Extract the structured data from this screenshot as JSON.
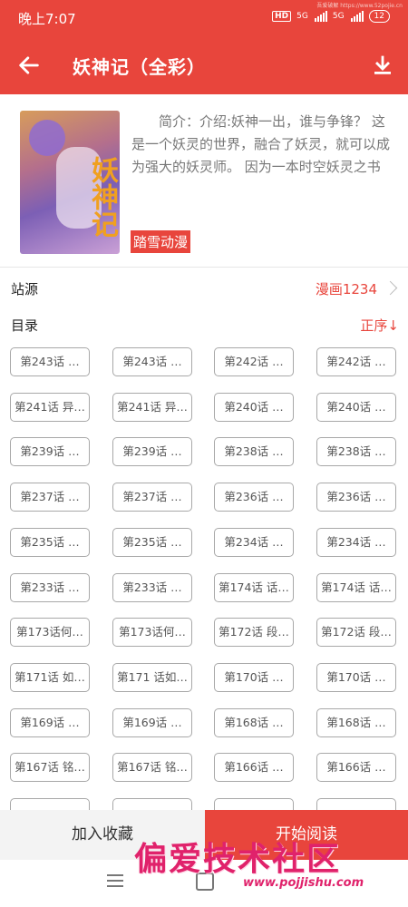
{
  "status": {
    "time": "晚上7:07",
    "network1": "5G",
    "network2": "5G",
    "battery": "12",
    "hd": "HD",
    "watermark": "吾爱破解 https://www.52pojie.cn"
  },
  "appbar": {
    "title": "妖神记（全彩）"
  },
  "info": {
    "description": "简介：介绍:妖神一出，谁与争锋？ 这是一个妖灵的世界，融合了妖灵，就可以成为强大的妖灵师。 因为一本时空妖灵之书",
    "cover_text": "妖神记",
    "tag": "踏雪动漫"
  },
  "source": {
    "label": "站源",
    "value": "漫画1234"
  },
  "toc": {
    "label": "目录",
    "order": "正序↓"
  },
  "chapters": [
    "第243话 …",
    "第243话 …",
    "第242话 …",
    "第242话 …",
    "第241话 异…",
    "第241话 异…",
    "第240话 …",
    "第240话 …",
    "第239话 …",
    "第239话 …",
    "第238话 …",
    "第238话 …",
    "第237话 …",
    "第237话 …",
    "第236话 …",
    "第236话 …",
    "第235话 …",
    "第235话 …",
    "第234话 …",
    "第234话 …",
    "第233话 …",
    "第233话 …",
    "第174话 话…",
    "第174话 话…",
    "第173话何…",
    "第173话何…",
    "第172话 段…",
    "第172话 段…",
    "第171话 如…",
    "第171 话如…",
    "第170话 …",
    "第170话 …",
    "第169话 …",
    "第169话 …",
    "第168话 …",
    "第168话 …",
    "第167话 铭…",
    "第167话 铭…",
    "第166话 …",
    "第166话 …",
    "",
    "",
    "",
    ""
  ],
  "actions": {
    "favorite": "加入收藏",
    "read": "开始阅读"
  },
  "watermark": {
    "title": "偏爱技术社区",
    "url": "www.pojjishu.com"
  },
  "colors": {
    "accent": "#e8453c",
    "chip_border": "#a8a8a8",
    "watermark": "#e0226b"
  },
  "icons": {
    "back": "arrow-left-icon",
    "download": "download-icon",
    "chevron": "chevron-right-icon",
    "menu": "menu-icon",
    "home": "home-icon"
  }
}
